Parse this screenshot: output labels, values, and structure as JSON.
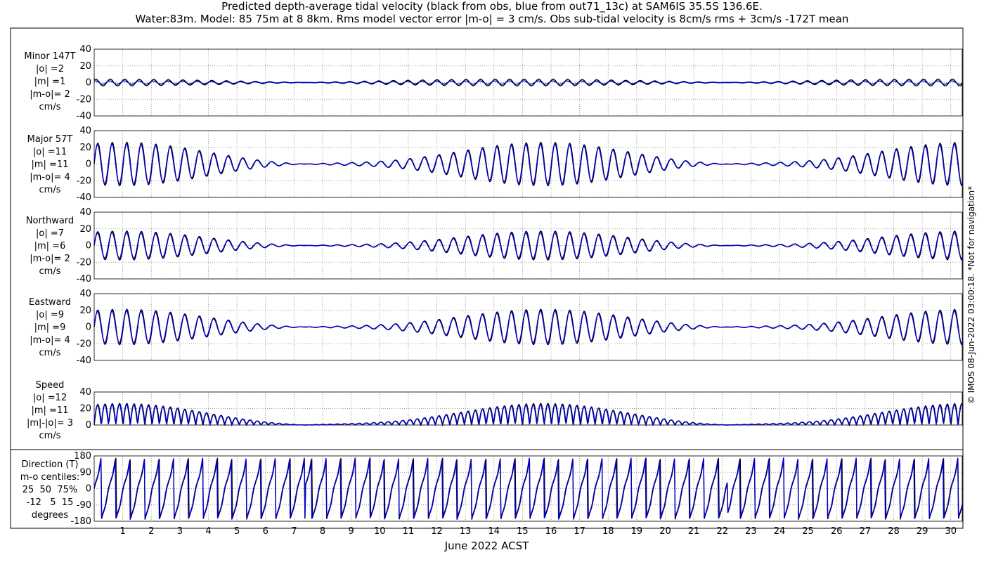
{
  "title_line1": "Predicted depth-average tidal velocity (black from obs, blue from out71_13c) at SAM6IS 35.5S 136.6E.",
  "title_line2": "Water:83m. Model: 85 75m at 8 8km. Rms model vector error |m-o| = 3 cm/s. Obs sub-tidal velocity is 8cm/s rms + 3cm/s -172T mean",
  "xlabel": "June 2022 ACST",
  "credit": "© IMOS 08-Jun-2022 03:00:18. *Not for navigation*",
  "colors": {
    "obs": "#000000",
    "model": "#0000cc"
  },
  "chart_data": [
    {
      "type": "line",
      "name": "minor",
      "label_lines": [
        "Minor 147T",
        "|o| =2",
        "|m| =1",
        "|m-o|= 2",
        "cm/s"
      ],
      "ylim": [
        -40,
        40
      ],
      "yticks": [
        -40,
        -20,
        0,
        20,
        40
      ],
      "amp_obs": 4,
      "amp_model": 2,
      "series": [
        {
          "name": "obs",
          "color": "#000000"
        },
        {
          "name": "model",
          "color": "#0000cc"
        }
      ]
    },
    {
      "type": "line",
      "name": "major",
      "label_lines": [
        "Major 57T",
        "|o| =11",
        "|m| =11",
        "|m-o|= 4",
        "cm/s"
      ],
      "ylim": [
        -40,
        40
      ],
      "yticks": [
        -40,
        -20,
        0,
        20,
        40
      ],
      "amp_obs": 27,
      "amp_model": 25,
      "series": [
        {
          "name": "obs",
          "color": "#000000"
        },
        {
          "name": "model",
          "color": "#0000cc"
        }
      ]
    },
    {
      "type": "line",
      "name": "northward",
      "label_lines": [
        "Northward",
        "|o| =7",
        "|m| =6",
        "|m-o|= 2",
        "cm/s"
      ],
      "ylim": [
        -40,
        40
      ],
      "yticks": [
        -40,
        -20,
        0,
        20,
        40
      ],
      "amp_obs": 18,
      "amp_model": 16,
      "series": [
        {
          "name": "obs",
          "color": "#000000"
        },
        {
          "name": "model",
          "color": "#0000cc"
        }
      ]
    },
    {
      "type": "line",
      "name": "eastward",
      "label_lines": [
        "Eastward",
        "|o| =9",
        "|m| =9",
        "|m-o|= 4",
        "cm/s"
      ],
      "ylim": [
        -40,
        40
      ],
      "yticks": [
        -40,
        -20,
        0,
        20,
        40
      ],
      "amp_obs": 22,
      "amp_model": 20,
      "series": [
        {
          "name": "obs",
          "color": "#000000"
        },
        {
          "name": "model",
          "color": "#0000cc"
        }
      ]
    },
    {
      "type": "line",
      "name": "speed",
      "label_lines": [
        "Speed",
        "|o| =12",
        "|m| =11",
        "|m|-|o|= 3",
        "cm/s"
      ],
      "ylim": [
        0,
        40
      ],
      "yticks": [
        0,
        20,
        40
      ],
      "amp_obs": 27,
      "amp_model": 26,
      "series": [
        {
          "name": "obs",
          "color": "#000000"
        },
        {
          "name": "model",
          "color": "#0000cc"
        }
      ]
    },
    {
      "type": "line",
      "name": "direction",
      "label_lines": [
        "Direction (T)",
        "m-o centiles:",
        "25  50  75%",
        "-12   5  15",
        "degrees"
      ],
      "ylim": [
        -180,
        180
      ],
      "yticks": [
        -180,
        -90,
        0,
        90,
        180
      ],
      "series": [
        {
          "name": "obs",
          "color": "#000000"
        },
        {
          "name": "model",
          "color": "#0000cc"
        }
      ]
    }
  ],
  "x_axis": {
    "xlim": [
      0,
      30.4
    ],
    "ticks": [
      1,
      2,
      3,
      4,
      5,
      6,
      7,
      8,
      9,
      10,
      11,
      12,
      13,
      14,
      15,
      16,
      17,
      18,
      19,
      20,
      21,
      22,
      23,
      24,
      25,
      26,
      27,
      28,
      29,
      30
    ],
    "grid": true
  }
}
